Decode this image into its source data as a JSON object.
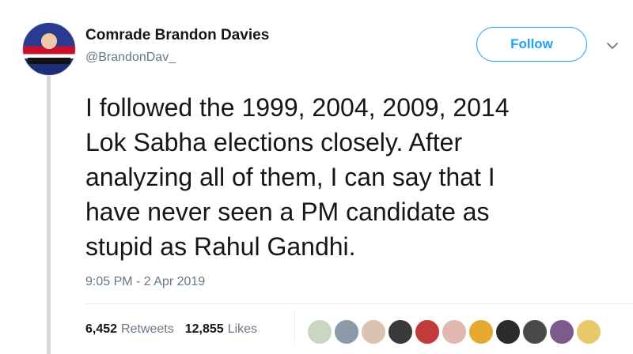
{
  "tweet": {
    "display_name": "Comrade Brandon Davies",
    "handle": "@BrandonDav_",
    "follow_label": "Follow",
    "text": "I followed the 1999, 2004, 2009, 2014\nLok Sabha elections closely. After\nanalyzing all of them, I can say that I\nhave never seen a PM candidate as\nstupid as Rahul Gandhi.",
    "timestamp": "9:05 PM - 2 Apr 2019",
    "retweets_count": "6,452",
    "retweets_label": "Retweets",
    "likes_count": "12,855",
    "likes_label": "Likes"
  },
  "colors": {
    "accent": "#1da1f2",
    "secondary_text": "#657786"
  },
  "likers": [
    {
      "color": "#c9d6c2"
    },
    {
      "color": "#8a9aa8"
    },
    {
      "color": "#d9c3b3"
    },
    {
      "color": "#3a3a3a"
    },
    {
      "color": "#c23a3a"
    },
    {
      "color": "#e0b8b0"
    },
    {
      "color": "#e7a832"
    },
    {
      "color": "#2b2b2b"
    },
    {
      "color": "#4a4a4a"
    },
    {
      "color": "#7d5a8c"
    },
    {
      "color": "#e8c96a"
    }
  ]
}
